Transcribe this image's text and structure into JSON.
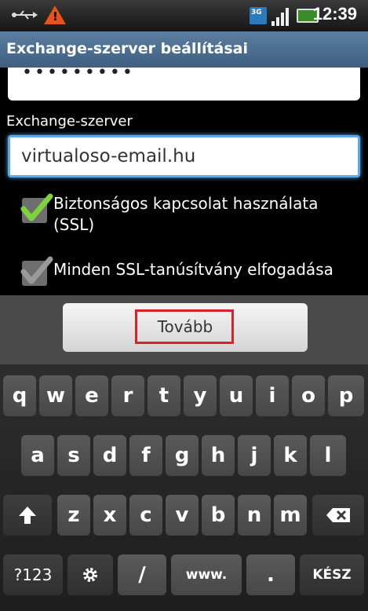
{
  "status_bar": {
    "usb_icon": "usb-icon",
    "warning_icon": "warning-icon",
    "warning_glyph": "!",
    "network_badge": "3G",
    "signal_icon": "signal-bars-icon",
    "battery_icon": "battery-icon",
    "time": "12:39"
  },
  "title": "Exchange-szerver beállításai",
  "form": {
    "password_mask": "•••••••••",
    "server_label": "Exchange-szerver",
    "server_value": "virtualoso-email.hu",
    "ssl_checkbox": {
      "label": "Biztonságos kapcsolat használata (SSL)",
      "checked": true
    },
    "accept_cert_checkbox": {
      "label": "Minden SSL-tanúsítvány elfogadása",
      "checked": true
    }
  },
  "next_button": {
    "label": "Tovább",
    "highlight_color": "#d8232a"
  },
  "keyboard": {
    "row1": [
      "q",
      "w",
      "e",
      "r",
      "t",
      "y",
      "u",
      "i",
      "o",
      "p"
    ],
    "row2": [
      "a",
      "s",
      "d",
      "f",
      "g",
      "h",
      "j",
      "k",
      "l"
    ],
    "row3": [
      "z",
      "x",
      "c",
      "v",
      "b",
      "n",
      "m"
    ],
    "shift_icon": "shift-arrow-icon",
    "backspace_icon": "backspace-icon",
    "row4": {
      "symbols": "?123",
      "settings_icon": "gear-icon",
      "slash": "/",
      "www": "www.",
      "dot": ".",
      "done": "KÉSZ"
    }
  },
  "colors": {
    "accent_focus": "#5aa8e8",
    "check_green": "#7cd33a",
    "title_bar": "#4a6d90"
  }
}
